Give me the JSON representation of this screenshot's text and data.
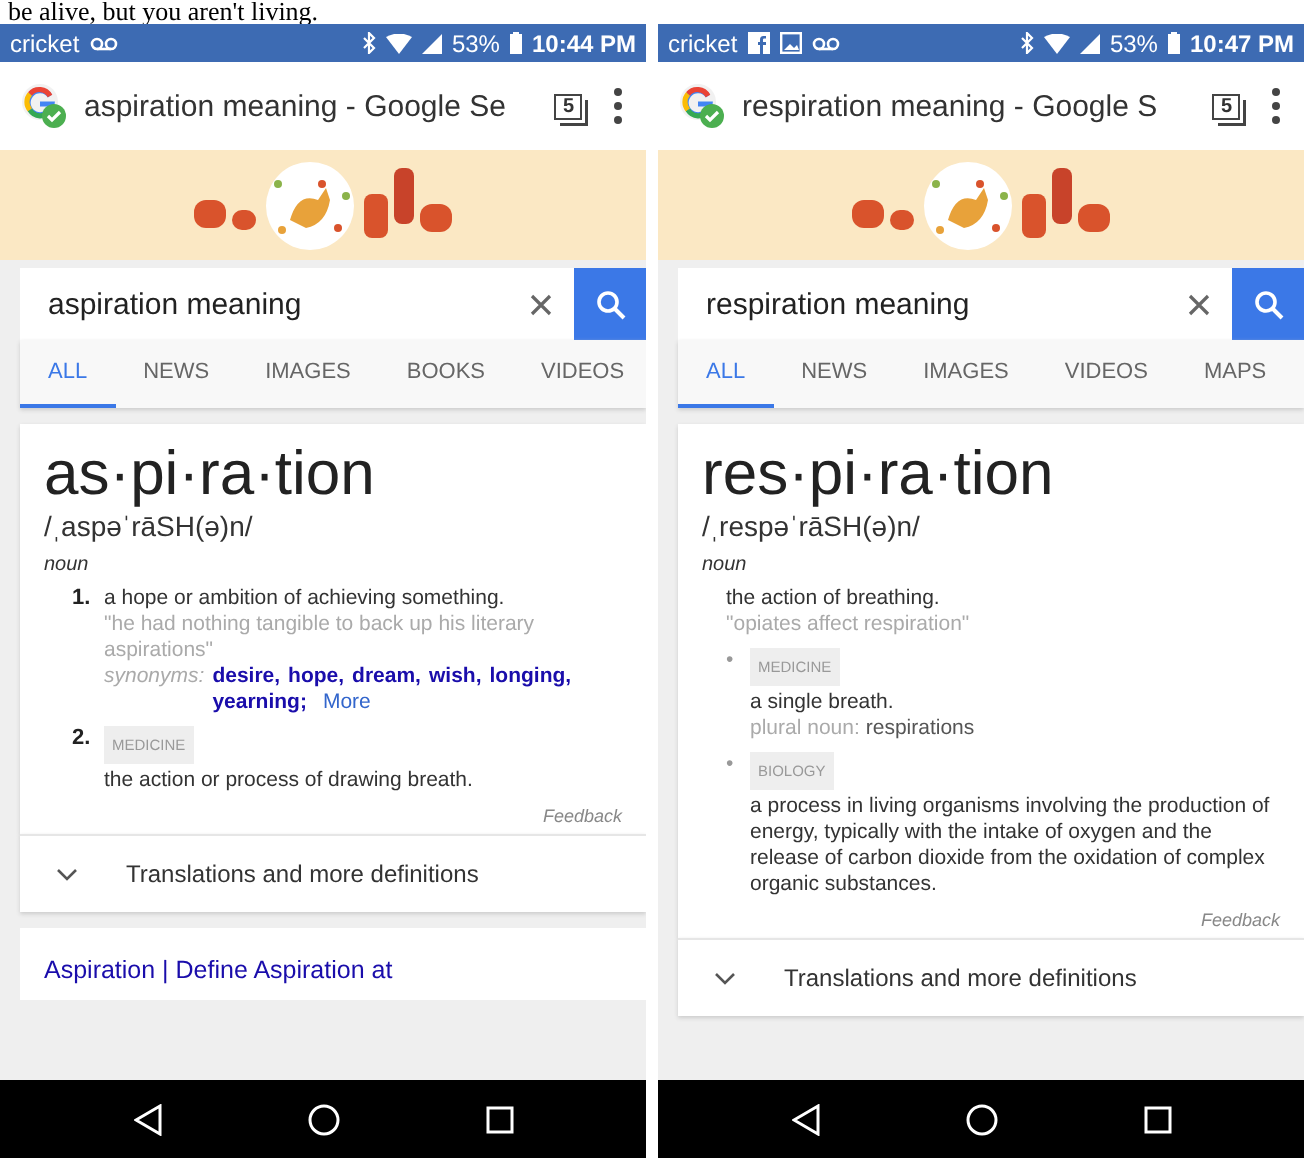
{
  "caption": "be alive, but you aren't living.",
  "phones": [
    {
      "status_bar": {
        "carrier": "cricket",
        "notification_icons": [
          {
            "kind": "voicemail"
          }
        ],
        "battery": "53%",
        "time": "10:44 PM"
      },
      "tab_title": "aspiration meaning - Google Se",
      "tab_count": "5",
      "search": {
        "value": "aspiration meaning"
      },
      "tabs": [
        {
          "label": "ALL",
          "selected": true
        },
        {
          "label": "NEWS",
          "selected": false
        },
        {
          "label": "IMAGES",
          "selected": false
        },
        {
          "label": "BOOKS",
          "selected": false
        },
        {
          "label": "VIDEOS",
          "selected": false
        }
      ],
      "definition": {
        "headword": "as·pi·ra·tion",
        "pronunciation": "/ˌaspəˈrāSH(ə)n/",
        "part_of_speech": "noun",
        "senses": [
          {
            "kind": "numbered",
            "number": "1.",
            "text": "a hope or ambition of achieving something.",
            "example": "\"he had nothing tangible to back up his literary aspirations\"",
            "synonyms_label": "synonyms:",
            "synonyms": [
              "desire,",
              "hope,",
              "dream,",
              "wish,",
              "longing,",
              "yearning;"
            ],
            "more": "More"
          },
          {
            "kind": "numbered",
            "number": "2.",
            "label": "MEDICINE",
            "text": "the action or process of drawing breath."
          }
        ],
        "feedback": "Feedback",
        "more_definitions": "Translations and more definitions"
      },
      "next_result": "Aspiration | Define Aspiration at"
    },
    {
      "status_bar": {
        "carrier": "cricket",
        "notification_icons": [
          {
            "kind": "facebook"
          },
          {
            "kind": "image"
          },
          {
            "kind": "voicemail"
          }
        ],
        "battery": "53%",
        "time": "10:47 PM"
      },
      "tab_title": "respiration meaning - Google S",
      "tab_count": "5",
      "search": {
        "value": "respiration meaning"
      },
      "tabs": [
        {
          "label": "ALL",
          "selected": true
        },
        {
          "label": "NEWS",
          "selected": false
        },
        {
          "label": "IMAGES",
          "selected": false
        },
        {
          "label": "VIDEOS",
          "selected": false
        },
        {
          "label": "MAPS",
          "selected": false
        }
      ],
      "definition": {
        "headword": "res·pi·ra·tion",
        "pronunciation": "/ˌrespəˈrāSH(ə)n/",
        "part_of_speech": "noun",
        "senses": [
          {
            "kind": "main",
            "text": "the action of breathing.",
            "example": "\"opiates affect respiration\""
          },
          {
            "kind": "bullet",
            "bullet": "•",
            "label": "MEDICINE",
            "text": "a single breath.",
            "plural_label": "plural noun:",
            "plural": "respirations"
          },
          {
            "kind": "bullet",
            "bullet": "•",
            "label": "BIOLOGY",
            "text": "a process in living organisms involving the production of energy, typically with the intake of oxygen and the release of carbon dioxide from the oxidation of complex organic substances."
          }
        ],
        "feedback": "Feedback",
        "more_definitions": "Translations and more definitions"
      }
    }
  ]
}
